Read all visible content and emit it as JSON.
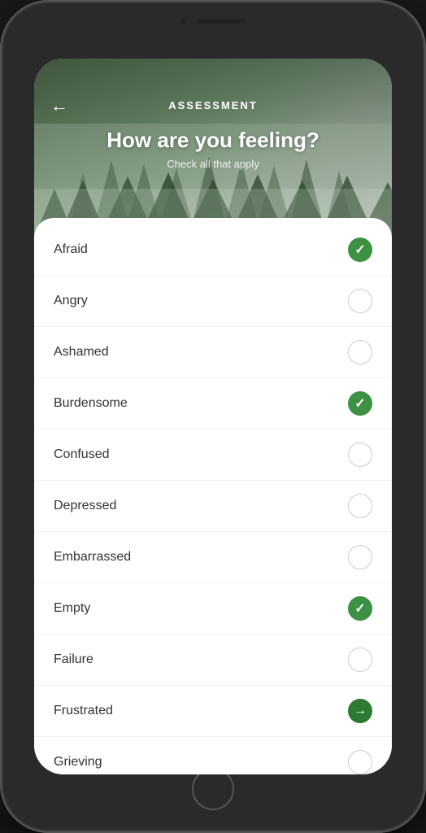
{
  "phone": {
    "speaker_label": "speaker",
    "camera_label": "camera"
  },
  "header": {
    "title": "ASSESSMENT",
    "back_label": "←",
    "question": "How are you feeling?",
    "subtitle": "Check all that apply"
  },
  "feelings": {
    "items": [
      {
        "label": "Afraid",
        "state": "checked"
      },
      {
        "label": "Angry",
        "state": "unchecked"
      },
      {
        "label": "Ashamed",
        "state": "unchecked"
      },
      {
        "label": "Burdensome",
        "state": "checked"
      },
      {
        "label": "Confused",
        "state": "unchecked"
      },
      {
        "label": "Depressed",
        "state": "unchecked"
      },
      {
        "label": "Embarrassed",
        "state": "unchecked"
      },
      {
        "label": "Empty",
        "state": "checked"
      },
      {
        "label": "Failure",
        "state": "unchecked"
      },
      {
        "label": "Frustrated",
        "state": "arrow"
      },
      {
        "label": "Grieving",
        "state": "unchecked"
      }
    ]
  },
  "colors": {
    "checked_bg": "#3d9142",
    "arrow_bg": "#2d7a32",
    "unchecked_border": "#cccccc"
  }
}
